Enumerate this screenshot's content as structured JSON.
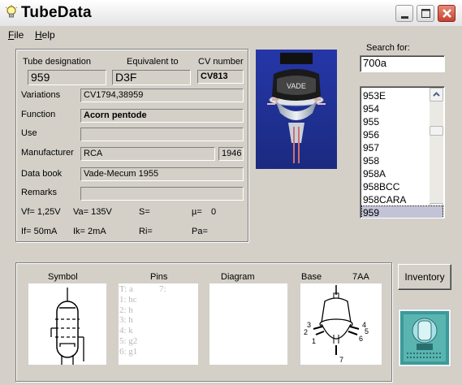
{
  "app": {
    "title": "TubeData"
  },
  "menu": {
    "file": "File",
    "file_ul": "F",
    "file_rest": "ile",
    "help_ul": "H",
    "help_rest": "elp"
  },
  "labels": {
    "tube_designation": "Tube designation",
    "equivalent_to": "Equivalent to",
    "cv_number": "CV number",
    "variations": "Variations",
    "function": "Function",
    "use": "Use",
    "manufacturer": "Manufacturer",
    "data_book": "Data book",
    "remarks": "Remarks",
    "search_for": "Search for:"
  },
  "tube": {
    "designation": "959",
    "equivalent": "D3F",
    "cv_number": "CV813",
    "variations": "CV1794,38959",
    "function": "Acorn pentode",
    "use": "",
    "manufacturer": "RCA",
    "year": "1946",
    "data_book": "Vade-Mecum 1955",
    "remarks": ""
  },
  "params": {
    "vf": "Vf= 1,25V",
    "va": "Va= 135V",
    "s": "S=",
    "mu": "µ=",
    "mu_val": "0",
    "if": "If= 50mA",
    "ik": "Ik= 2mA",
    "ri": "Ri=",
    "pa": "Pa="
  },
  "search": {
    "value": "700a"
  },
  "tube_list": [
    "953E",
    "954",
    "955",
    "956",
    "957",
    "958",
    "958A",
    "958BCC",
    "958CARA",
    "959"
  ],
  "tube_list_selected": "959",
  "bottom": {
    "symbol": "Symbol",
    "pins": "Pins",
    "diagram": "Diagram",
    "base": "Base",
    "base_code": "7AA",
    "pin_list": [
      {
        "pin": "T:",
        "name": "a"
      },
      {
        "pin": "1:",
        "name": "hc"
      },
      {
        "pin": "2:",
        "name": "h"
      },
      {
        "pin": "3:",
        "name": "h"
      },
      {
        "pin": "4:",
        "name": "k"
      },
      {
        "pin": "5:",
        "name": "g2"
      },
      {
        "pin": "6:",
        "name": "g1"
      }
    ],
    "pin7": "7:",
    "base_numbers": [
      "1",
      "2",
      "3",
      "4",
      "5",
      "6",
      "7"
    ]
  },
  "inventory_button": "Inventory",
  "colors": {
    "close_button": "#c6422f",
    "selection": "#c3c3d8",
    "photo_bg": "#1a2a8a"
  }
}
